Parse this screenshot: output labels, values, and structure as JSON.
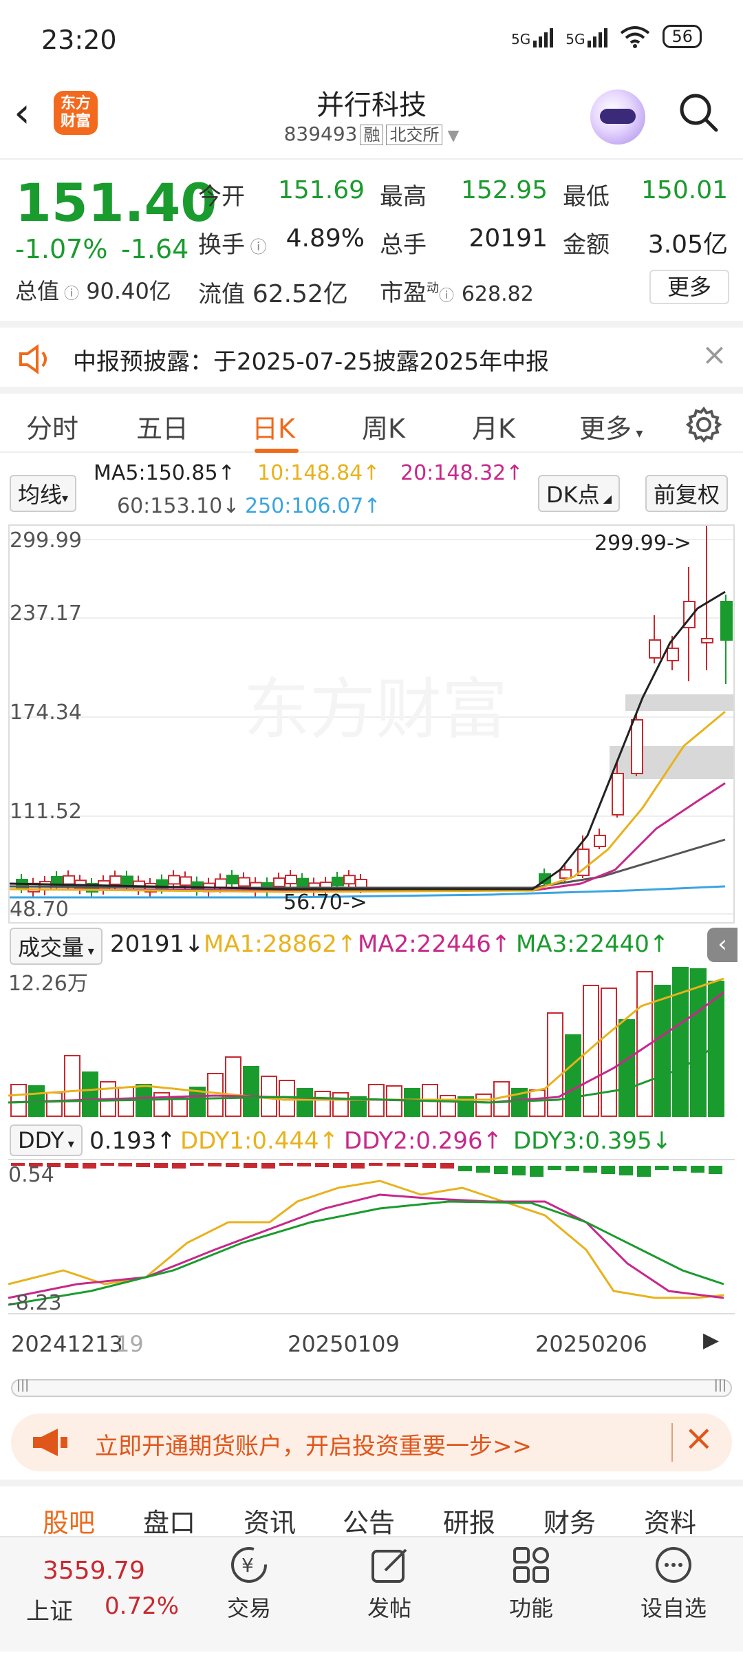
{
  "status": {
    "time": "23:20",
    "net1": "5G",
    "net2": "5G",
    "battery": "56"
  },
  "header": {
    "logo_text_1": "东方",
    "logo_text_2": "财富",
    "name": "并行科技",
    "code": "839493",
    "tag1": "融",
    "tag2": "北交所"
  },
  "quote": {
    "price": "151.40",
    "change_pct": "-1.07%",
    "change": "-1.64",
    "open_label": "今开",
    "open": "151.69",
    "high_label": "最高",
    "high": "152.95",
    "low_label": "最低",
    "low": "150.01",
    "turnover_label": "换手",
    "turnover": "4.89%",
    "volume_label": "总手",
    "volume": "20191",
    "amount_label": "金额",
    "amount": "3.05亿",
    "mcap_label": "总值",
    "mcap": "90.40亿",
    "float_label": "流值",
    "float": "62.52亿",
    "pe_label": "市盈",
    "pe_sup": "动",
    "pe": "628.82",
    "more": "更多"
  },
  "notice": {
    "text": "中报预披露：于2025-07-25披露2025年中报"
  },
  "tabs": [
    "分时",
    "五日",
    "日K",
    "周K",
    "月K",
    "更多"
  ],
  "ma": {
    "selector": "均线",
    "ma5": "MA5:150.85↑",
    "ma10": "10:148.84↑",
    "ma20": "20:148.32↑",
    "ma60": "60:153.10↓",
    "ma250": "250:106.07↑",
    "dk": "DK点",
    "adjust": "前复权"
  },
  "kline": {
    "y1": "299.99",
    "y2": "237.17",
    "y3": "174.34",
    "y4": "111.52",
    "y5": "48.70",
    "hi_mark": "299.99->",
    "lo_mark": "56.70->",
    "watermark": "东方财富"
  },
  "volume": {
    "selector": "成交量",
    "value": "20191↓",
    "ma1": "MA1:28862↑",
    "ma2": "MA2:22446↑",
    "ma3": "MA3:22440↑",
    "ymax": "12.26万"
  },
  "ddy": {
    "selector": "DDY",
    "value": "0.193↑",
    "d1": "DDY1:0.444↑",
    "d2": "DDY2:0.296↑",
    "d3": "DDY3:0.395↓",
    "ymax": "0.54",
    "ymin": "-8.23"
  },
  "dates": {
    "d1": "20241213",
    "d1b": "19",
    "d2": "20250109",
    "d3": "20250206"
  },
  "banner": {
    "text": "立即开通期货账户，开启投资重要一步>>"
  },
  "bottom_tabs": [
    "股吧",
    "盘口",
    "资讯",
    "公告",
    "研报",
    "财务",
    "资料"
  ],
  "dock": {
    "index_value": "3559.79",
    "index_name": "上证",
    "index_change": "0.72%",
    "trade": "交易",
    "post": "发帖",
    "func": "功能",
    "watch": "设自选"
  },
  "colors": {
    "up": "#c8282f",
    "down": "#1a9b2e",
    "accent": "#ef6a1a"
  }
}
